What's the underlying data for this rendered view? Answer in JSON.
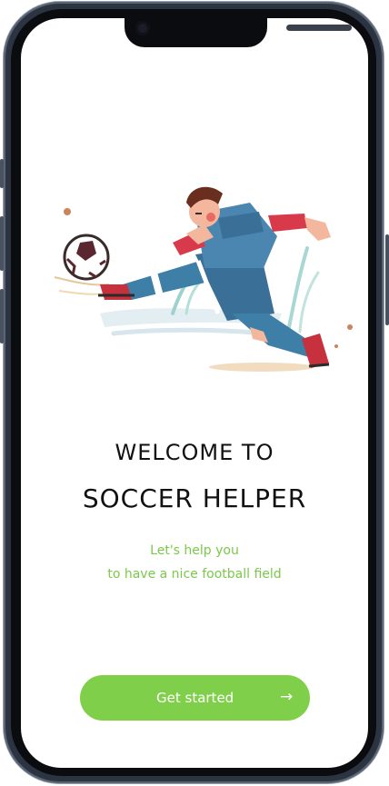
{
  "welcome": {
    "line1": "WELCOME TO",
    "line2": "SOCCER HELPER",
    "subtitle_line1": "Let's help you",
    "subtitle_line2": "to have a  nice football field"
  },
  "cta": {
    "label": "Get started",
    "arrow": "→"
  },
  "illustration": {
    "icon": "soccer-player-kicking-ball"
  },
  "colors": {
    "accent_green": "#80cf4b",
    "subtitle_green": "#7bc84a",
    "title_text": "#111111"
  }
}
